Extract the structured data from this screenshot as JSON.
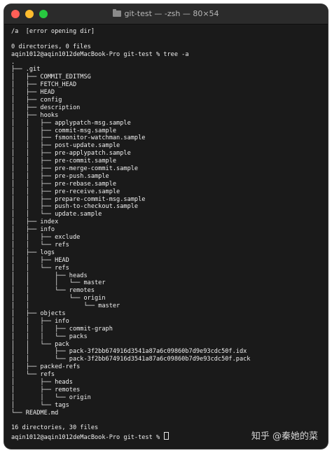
{
  "window": {
    "title": "git-test — -zsh — 80×54"
  },
  "terminal": {
    "lines": [
      "/a  [error opening dir]",
      "",
      "0 directories, 0 files",
      "aqin1012@aqin1012deMacBook-Pro git-test % tree -a",
      ".",
      "├── .git",
      "│   ├── COMMIT_EDITMSG",
      "│   ├── FETCH_HEAD",
      "│   ├── HEAD",
      "│   ├── config",
      "│   ├── description",
      "│   ├── hooks",
      "│   │   ├── applypatch-msg.sample",
      "│   │   ├── commit-msg.sample",
      "│   │   ├── fsmonitor-watchman.sample",
      "│   │   ├── post-update.sample",
      "│   │   ├── pre-applypatch.sample",
      "│   │   ├── pre-commit.sample",
      "│   │   ├── pre-merge-commit.sample",
      "│   │   ├── pre-push.sample",
      "│   │   ├── pre-rebase.sample",
      "│   │   ├── pre-receive.sample",
      "│   │   ├── prepare-commit-msg.sample",
      "│   │   ├── push-to-checkout.sample",
      "│   │   └── update.sample",
      "│   ├── index",
      "│   ├── info",
      "│   │   ├── exclude",
      "│   │   └── refs",
      "│   ├── logs",
      "│   │   ├── HEAD",
      "│   │   └── refs",
      "│   │       ├── heads",
      "│   │       │   └── master",
      "│   │       └── remotes",
      "│   │           └── origin",
      "│   │               └── master",
      "│   ├── objects",
      "│   │   ├── info",
      "│   │   │   ├── commit-graph",
      "│   │   │   └── packs",
      "│   │   └── pack",
      "│   │       ├── pack-3f2bb674916d3541a87a6c09860b7d9e93cdc50f.idx",
      "│   │       └── pack-3f2bb674916d3541a87a6c09860b7d9e93cdc50f.pack",
      "│   ├── packed-refs",
      "│   └── refs",
      "│       ├── heads",
      "│       ├── remotes",
      "│       │   └── origin",
      "│       └── tags",
      "└── README.md",
      "",
      "16 directories, 30 files",
      "aqin1012@aqin1012deMacBook-Pro git-test % "
    ]
  },
  "watermark": "知乎 @秦她的菜"
}
